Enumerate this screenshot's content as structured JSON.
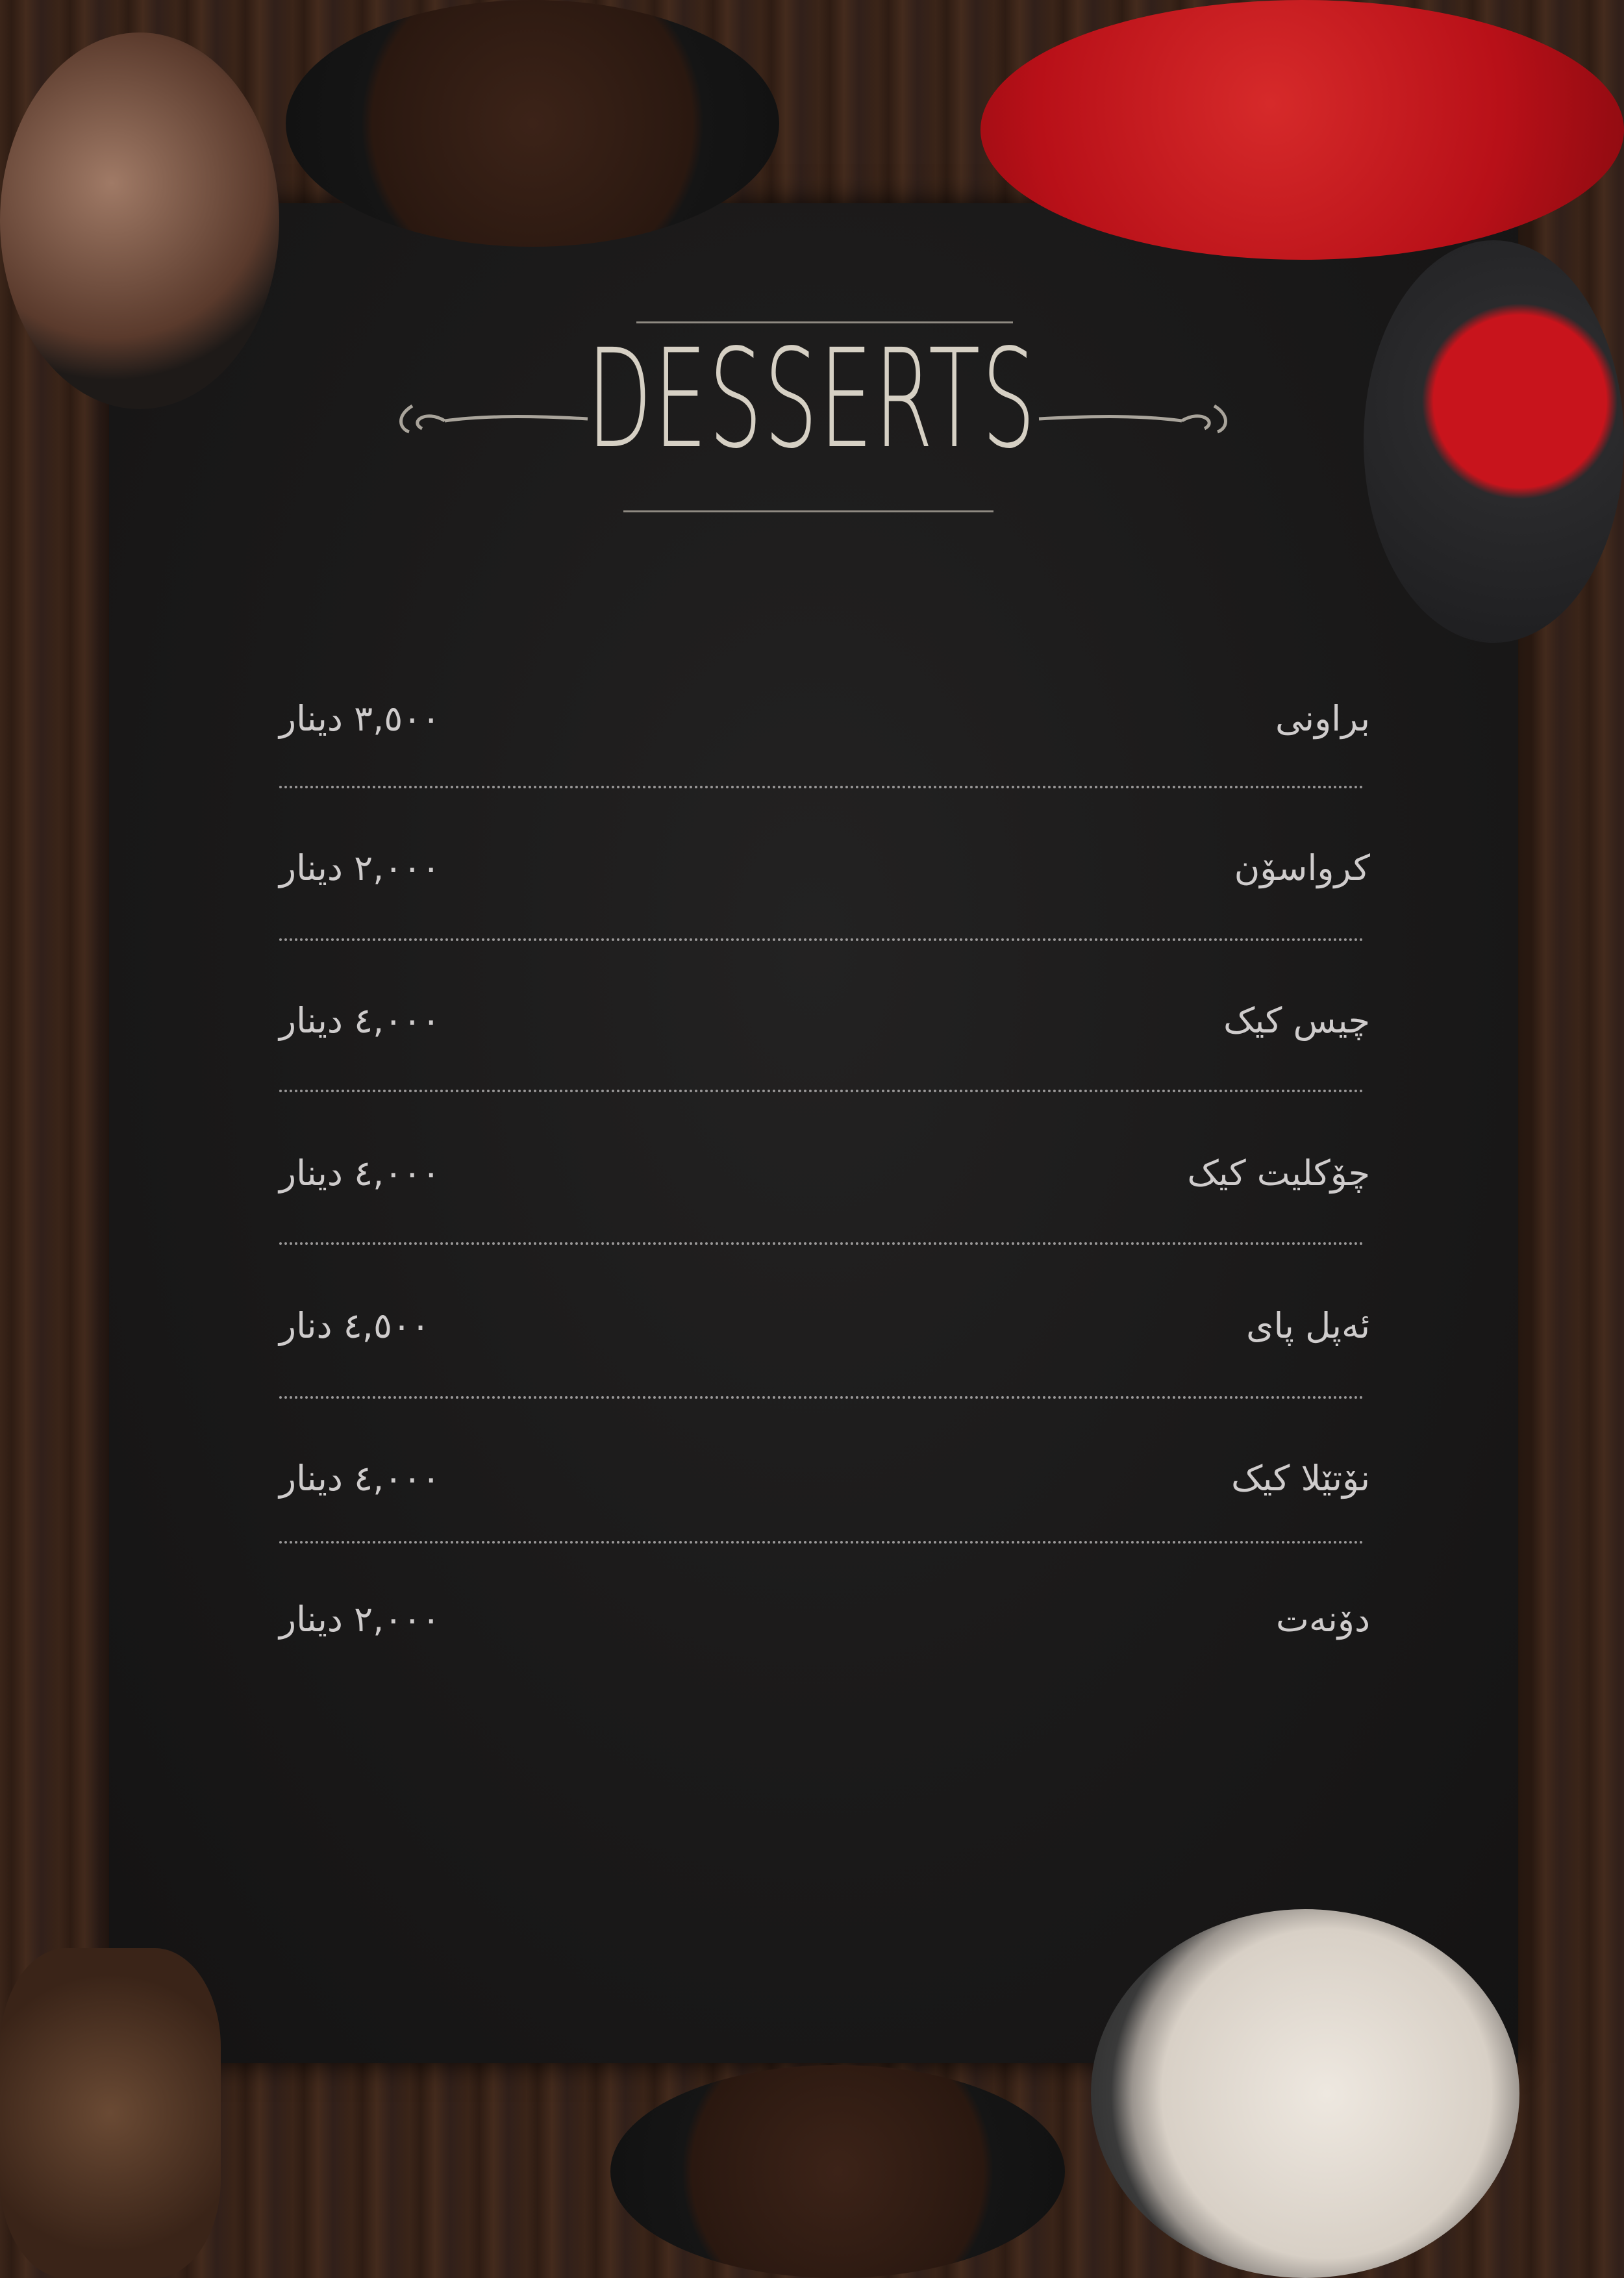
{
  "menu": {
    "title": "DESSERTS",
    "items": [
      {
        "name": "براونی",
        "price": "٣,٥٠٠ دینار"
      },
      {
        "name": "کرواسۆن",
        "price": "٢,٠٠٠ دینار"
      },
      {
        "name": "چیس کیک",
        "price": "٤,٠٠٠ دینار"
      },
      {
        "name": "چۆکلیت کیک",
        "price": "٤,٠٠٠ دینار"
      },
      {
        "name": "ئەپل پای",
        "price": "٤,٥٠٠ دنار"
      },
      {
        "name": "نۆتێلا کیک",
        "price": "٤,٠٠٠ دینار"
      },
      {
        "name": "دۆنەت",
        "price": "٢,٠٠٠ دینار"
      }
    ]
  },
  "colors": {
    "board": "#1b1a1a",
    "wood": "#3a2418",
    "text": "#cfcccc",
    "strawberry": "#c8141c"
  }
}
